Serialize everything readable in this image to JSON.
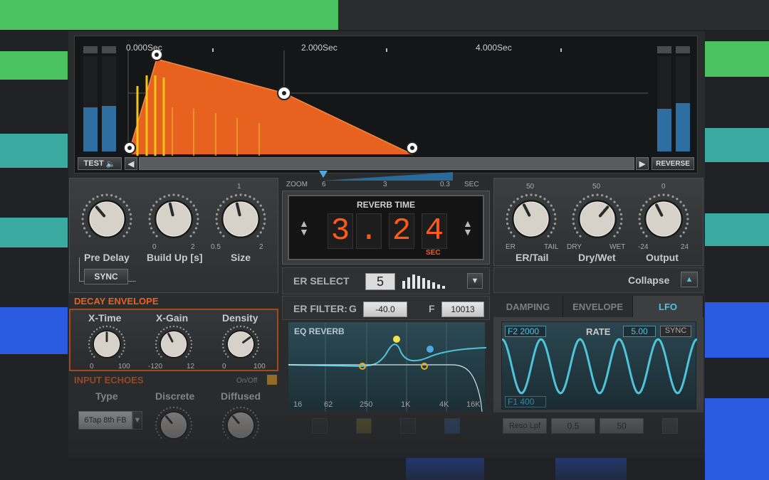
{
  "colors": {
    "accent": "#e8621f",
    "lfo_teal": "#4fc3d8",
    "display_orange": "#ff5a1a",
    "yellow": "#f3c51a",
    "background_bar_green": "#49c25f",
    "background_bar_teal": "#3aa9a0",
    "background_bar_blue": "#2a5be0"
  },
  "timeline": {
    "marks": [
      "0.000Sec",
      "2.000Sec",
      "4.000Sec"
    ],
    "test_button": "TEST",
    "reverse_button": "REVERSE"
  },
  "zoom": {
    "label": "ZOOM",
    "ticks": [
      "6",
      "3",
      "0.3"
    ],
    "unit": "SEC"
  },
  "reverb_time": {
    "title": "REVERB TIME",
    "digits": [
      "3",
      ".",
      "2",
      "4"
    ],
    "unit": "SEC"
  },
  "left_knobs": {
    "pre_delay": {
      "label": "Pre Delay",
      "value": 0.35
    },
    "build_up": {
      "label": "Build Up [s]",
      "min": "0",
      "max": "2",
      "value": 0.45
    },
    "size": {
      "label": "Size",
      "top": "1",
      "min": "0.5",
      "max": "2",
      "value": 0.45
    },
    "sync_button": "SYNC"
  },
  "right_knobs": {
    "er_tail": {
      "label": "ER/Tail",
      "top": "50",
      "min": "ER",
      "max": "TAIL",
      "value": 0.4
    },
    "dry_wet": {
      "label": "Dry/Wet",
      "top": "50",
      "min": "DRY",
      "max": "WET",
      "value": 0.65
    },
    "output": {
      "label": "Output",
      "top": "0",
      "min": "-24",
      "max": "24",
      "value": 0.4
    }
  },
  "collapse": {
    "label": "Collapse"
  },
  "decay_envelope": {
    "title": "DECAY ENVELOPE",
    "x_time": {
      "label": "X-Time",
      "min": "0",
      "max": "100",
      "value": 0.5
    },
    "x_gain": {
      "label": "X-Gain",
      "min": "-120",
      "max": "12",
      "value": 0.4
    },
    "density": {
      "label": "Density",
      "min": "0",
      "max": "100",
      "value": 0.7
    }
  },
  "input_echoes": {
    "title": "INPUT ECHOES",
    "toggle": "On/Off",
    "type_label": "Type",
    "type_value": "6Tap 8th FB",
    "discrete_label": "Discrete",
    "diffused_label": "Diffused"
  },
  "er_select": {
    "label": "ER SELECT",
    "value": "5",
    "bars": [
      0.55,
      0.8,
      1.0,
      0.9,
      0.75,
      0.6,
      0.45,
      0.3,
      0.2
    ]
  },
  "er_filter": {
    "label": "ER FILTER:",
    "g_label": "G",
    "g_value": "-40.0",
    "f_label": "F",
    "f_value": "10013"
  },
  "eq": {
    "title": "EQ REVERB",
    "freq_labels": [
      "16",
      "62",
      "250",
      "1K",
      "4K",
      "16K"
    ]
  },
  "tabs": [
    "DAMPING",
    "ENVELOPE",
    "LFO"
  ],
  "lfo": {
    "f2_label": "F2",
    "f2_value": "2000",
    "rate_label": "RATE",
    "rate_value": "5.00",
    "sync_label": "SYNC",
    "f1_label": "F1",
    "f1_value": "400",
    "cycles": 5
  },
  "lfo_bottom": {
    "type_value": "Reso Lpf",
    "val1": "0.5",
    "val2": "50"
  }
}
